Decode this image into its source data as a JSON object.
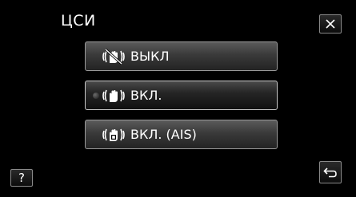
{
  "header": {
    "title": "ЦСИ",
    "close_icon": "close-icon"
  },
  "options": [
    {
      "label": "ВЫКЛ",
      "icon": "stabilizer-off-icon",
      "selected": false
    },
    {
      "label": "ВКЛ.",
      "icon": "stabilizer-on-icon",
      "selected": true
    },
    {
      "label": "ВКЛ. (AIS)",
      "icon": "stabilizer-ais-icon",
      "selected": false
    }
  ],
  "footer": {
    "help_label": "?",
    "back_icon": "back-icon"
  }
}
